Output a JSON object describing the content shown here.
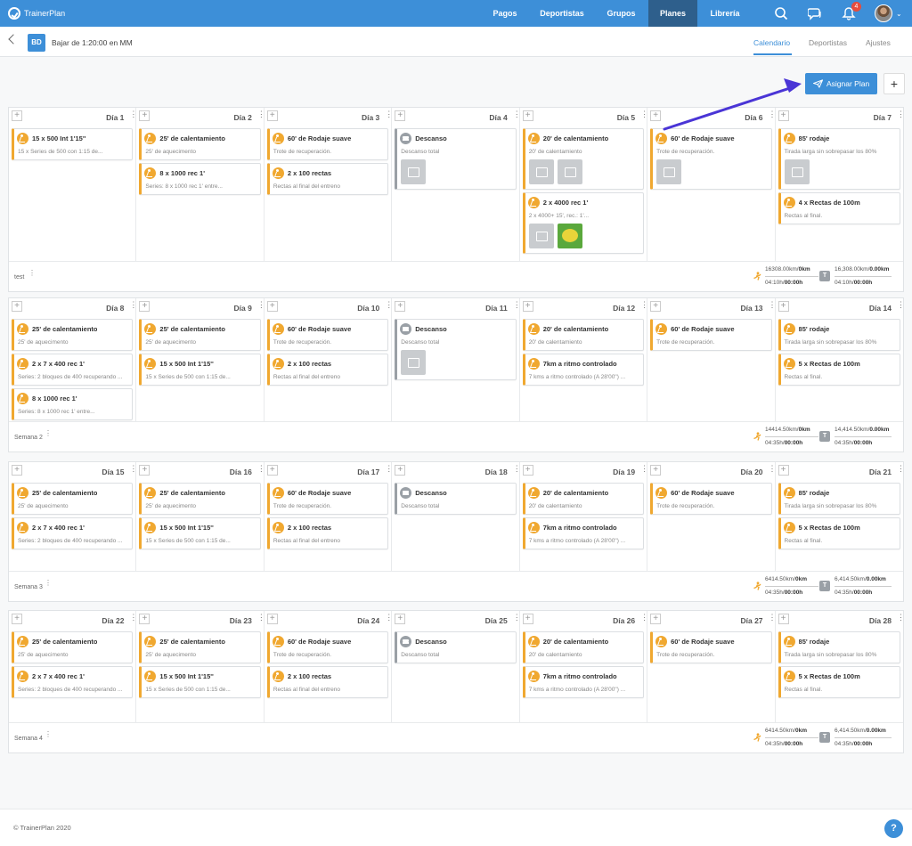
{
  "nav": {
    "brand": "TrainerPlan",
    "links": [
      "Pagos",
      "Deportistas",
      "Grupos",
      "Planes",
      "Librería"
    ],
    "active": "Planes",
    "notification_count": "4"
  },
  "subheader": {
    "plan_badge": "BD",
    "plan_title": "Bajar de 1:20:00 en MM",
    "tabs": [
      "Calendario",
      "Deportistas",
      "Ajustes"
    ],
    "active_tab": "Calendario"
  },
  "actions": {
    "assign_label": "Asignar Plan",
    "add_label": "+"
  },
  "weeks": [
    {
      "label": "test",
      "stats": {
        "run_a": "16308.00km/",
        "run_a_b": "0km",
        "run_b": "04:10h/",
        "run_b_b": "00:00h",
        "tot_a": "16,308.00km/",
        "tot_a_b": "0.00km",
        "tot_b": "04:10h/",
        "tot_b_b": "00:00h"
      },
      "days": [
        {
          "name": "Día 1",
          "items": [
            {
              "type": "run",
              "title": "15 x 500 Int 1'15''",
              "desc": "15 x Series de 500 con 1:15 de..."
            }
          ]
        },
        {
          "name": "Día 2",
          "items": [
            {
              "type": "run",
              "title": "25' de calentamiento",
              "desc": "25' de aquecimento"
            },
            {
              "type": "run",
              "title": "8 x 1000 rec 1'",
              "desc": "Series: 8 x 1000 rec 1' entre..."
            }
          ]
        },
        {
          "name": "Día 3",
          "items": [
            {
              "type": "run",
              "title": "60' de Rodaje suave",
              "desc": "Trote de recuperación."
            },
            {
              "type": "run",
              "title": "2 x 100 rectas",
              "desc": "Rectas al final del entreno"
            }
          ]
        },
        {
          "name": "Día 4",
          "items": [
            {
              "type": "rest",
              "title": "Descanso",
              "desc": "Descanso total",
              "thumbs": [
                "file"
              ]
            }
          ]
        },
        {
          "name": "Día 5",
          "items": [
            {
              "type": "run",
              "title": "20' de calentamiento",
              "desc": "20' de calentamiento",
              "thumbs": [
                "img",
                "img"
              ]
            },
            {
              "type": "run",
              "title": "2 x 4000 rec 1'",
              "desc": "2 x 4000+ 15', rec.: 1'...",
              "thumbs": [
                "file",
                "lemon"
              ]
            }
          ]
        },
        {
          "name": "Día 6",
          "items": [
            {
              "type": "run",
              "title": "60' de Rodaje suave",
              "desc": "Trote de recuperación.",
              "thumbs": [
                "img"
              ]
            }
          ]
        },
        {
          "name": "Día 7",
          "items": [
            {
              "type": "run",
              "title": "85' rodaje",
              "desc": "Tirada larga sin sobrepasar los 80%",
              "thumbs": [
                "img"
              ]
            },
            {
              "type": "run",
              "title": "4 x Rectas de 100m",
              "desc": "Rectas al final."
            }
          ]
        }
      ]
    },
    {
      "label": "Semana 2",
      "stats": {
        "run_a": "14414.50km/",
        "run_a_b": "0km",
        "run_b": "04:35h/",
        "run_b_b": "00:00h",
        "tot_a": "14,414.50km/",
        "tot_a_b": "0.00km",
        "tot_b": "04:35h/",
        "tot_b_b": "00:00h"
      },
      "days": [
        {
          "name": "Día 8",
          "items": [
            {
              "type": "run",
              "title": "25' de calentamiento",
              "desc": "25' de aquecimento"
            },
            {
              "type": "run",
              "title": "2 x 7 x 400 rec 1'",
              "desc": "Series: 2 bloques de 400 recuperando ..."
            },
            {
              "type": "run",
              "title": "8 x 1000 rec 1'",
              "desc": "Series: 8 x 1000 rec 1' entre..."
            }
          ]
        },
        {
          "name": "Día 9",
          "items": [
            {
              "type": "run",
              "title": "25' de calentamiento",
              "desc": "25' de aquecimento"
            },
            {
              "type": "run",
              "title": "15 x 500 Int 1'15''",
              "desc": "15 x Series de 500 con 1:15 de..."
            }
          ]
        },
        {
          "name": "Día 10",
          "items": [
            {
              "type": "run",
              "title": "60' de Rodaje suave",
              "desc": "Trote de recuperación."
            },
            {
              "type": "run",
              "title": "2 x 100 rectas",
              "desc": "Rectas al final del entreno"
            }
          ]
        },
        {
          "name": "Día 11",
          "items": [
            {
              "type": "rest",
              "title": "Descanso",
              "desc": "Descanso total",
              "thumbs": [
                "img"
              ]
            }
          ]
        },
        {
          "name": "Día 12",
          "items": [
            {
              "type": "run",
              "title": "20' de calentamiento",
              "desc": "20' de calentamiento"
            },
            {
              "type": "run",
              "title": "7km a ritmo controlado",
              "desc": "7 kms a ritmo controlado (A 28'00'') ..."
            }
          ]
        },
        {
          "name": "Día 13",
          "items": [
            {
              "type": "run",
              "title": "60' de Rodaje suave",
              "desc": "Trote de recuperación."
            }
          ]
        },
        {
          "name": "Día 14",
          "items": [
            {
              "type": "run",
              "title": "85' rodaje",
              "desc": "Tirada larga sin sobrepasar los 80%"
            },
            {
              "type": "run",
              "title": "5 x Rectas de 100m",
              "desc": "Rectas al final."
            }
          ]
        }
      ]
    },
    {
      "label": "Semana 3",
      "stats": {
        "run_a": "6414.50km/",
        "run_a_b": "0km",
        "run_b": "04:35h/",
        "run_b_b": "00:00h",
        "tot_a": "6,414.50km/",
        "tot_a_b": "0.00km",
        "tot_b": "04:35h/",
        "tot_b_b": "00:00h"
      },
      "days": [
        {
          "name": "Día 15",
          "items": [
            {
              "type": "run",
              "title": "25' de calentamiento",
              "desc": "25' de aquecimento"
            },
            {
              "type": "run",
              "title": "2 x 7 x 400 rec 1'",
              "desc": "Series: 2 bloques de 400 recuperando ..."
            }
          ]
        },
        {
          "name": "Día 16",
          "items": [
            {
              "type": "run",
              "title": "25' de calentamiento",
              "desc": "25' de aquecimento"
            },
            {
              "type": "run",
              "title": "15 x 500 Int 1'15''",
              "desc": "15 x Series de 500 con 1:15 de..."
            }
          ]
        },
        {
          "name": "Día 17",
          "items": [
            {
              "type": "run",
              "title": "60' de Rodaje suave",
              "desc": "Trote de recuperación."
            },
            {
              "type": "run",
              "title": "2 x 100 rectas",
              "desc": "Rectas al final del entreno"
            }
          ]
        },
        {
          "name": "Día 18",
          "items": [
            {
              "type": "rest",
              "title": "Descanso",
              "desc": "Descanso total"
            }
          ]
        },
        {
          "name": "Día 19",
          "items": [
            {
              "type": "run",
              "title": "20' de calentamiento",
              "desc": "20' de calentamiento"
            },
            {
              "type": "run",
              "title": "7km a ritmo controlado",
              "desc": "7 kms a ritmo controlado (A 28'00'') ..."
            }
          ]
        },
        {
          "name": "Día 20",
          "items": [
            {
              "type": "run",
              "title": "60' de Rodaje suave",
              "desc": "Trote de recuperación."
            }
          ]
        },
        {
          "name": "Día 21",
          "items": [
            {
              "type": "run",
              "title": "85' rodaje",
              "desc": "Tirada larga sin sobrepasar los 80%"
            },
            {
              "type": "run",
              "title": "5 x Rectas de 100m",
              "desc": "Rectas al final."
            }
          ]
        }
      ]
    },
    {
      "label": "Semana 4",
      "stats": {
        "run_a": "6414.50km/",
        "run_a_b": "0km",
        "run_b": "04:35h/",
        "run_b_b": "00:00h",
        "tot_a": "6,414.50km/",
        "tot_a_b": "0.00km",
        "tot_b": "04:35h/",
        "tot_b_b": "00:00h"
      },
      "days": [
        {
          "name": "Día 22",
          "items": [
            {
              "type": "run",
              "title": "25' de calentamiento",
              "desc": "25' de aquecimento"
            },
            {
              "type": "run",
              "title": "2 x 7 x 400 rec 1'",
              "desc": "Series: 2 bloques de 400 recuperando ..."
            }
          ]
        },
        {
          "name": "Día 23",
          "items": [
            {
              "type": "run",
              "title": "25' de calentamiento",
              "desc": "25' de aquecimento"
            },
            {
              "type": "run",
              "title": "15 x 500 Int 1'15''",
              "desc": "15 x Series de 500 con 1:15 de..."
            }
          ]
        },
        {
          "name": "Día 24",
          "items": [
            {
              "type": "run",
              "title": "60' de Rodaje suave",
              "desc": "Trote de recuperación."
            },
            {
              "type": "run",
              "title": "2 x 100 rectas",
              "desc": "Rectas al final del entreno"
            }
          ]
        },
        {
          "name": "Día 25",
          "items": [
            {
              "type": "rest",
              "title": "Descanso",
              "desc": "Descanso total"
            }
          ]
        },
        {
          "name": "Día 26",
          "items": [
            {
              "type": "run",
              "title": "20' de calentamiento",
              "desc": "20' de calentamiento"
            },
            {
              "type": "run",
              "title": "7km a ritmo controlado",
              "desc": "7 kms a ritmo controlado (A 28'00'') ..."
            }
          ]
        },
        {
          "name": "Día 27",
          "items": [
            {
              "type": "run",
              "title": "60' de Rodaje suave",
              "desc": "Trote de recuperación."
            }
          ]
        },
        {
          "name": "Día 28",
          "items": [
            {
              "type": "run",
              "title": "85' rodaje",
              "desc": "Tirada larga sin sobrepasar los 80%"
            },
            {
              "type": "run",
              "title": "5 x Rectas de 100m",
              "desc": "Rectas al final."
            }
          ]
        }
      ]
    }
  ],
  "footer": {
    "copyright": "© TrainerPlan 2020",
    "help": "?"
  },
  "colors": {
    "primary": "#3d8fd8",
    "nav_active": "#2e5f8c",
    "run_accent": "#f0a830",
    "rest_accent": "#9aa0a6",
    "annotation_arrow": "#4a35d6"
  }
}
